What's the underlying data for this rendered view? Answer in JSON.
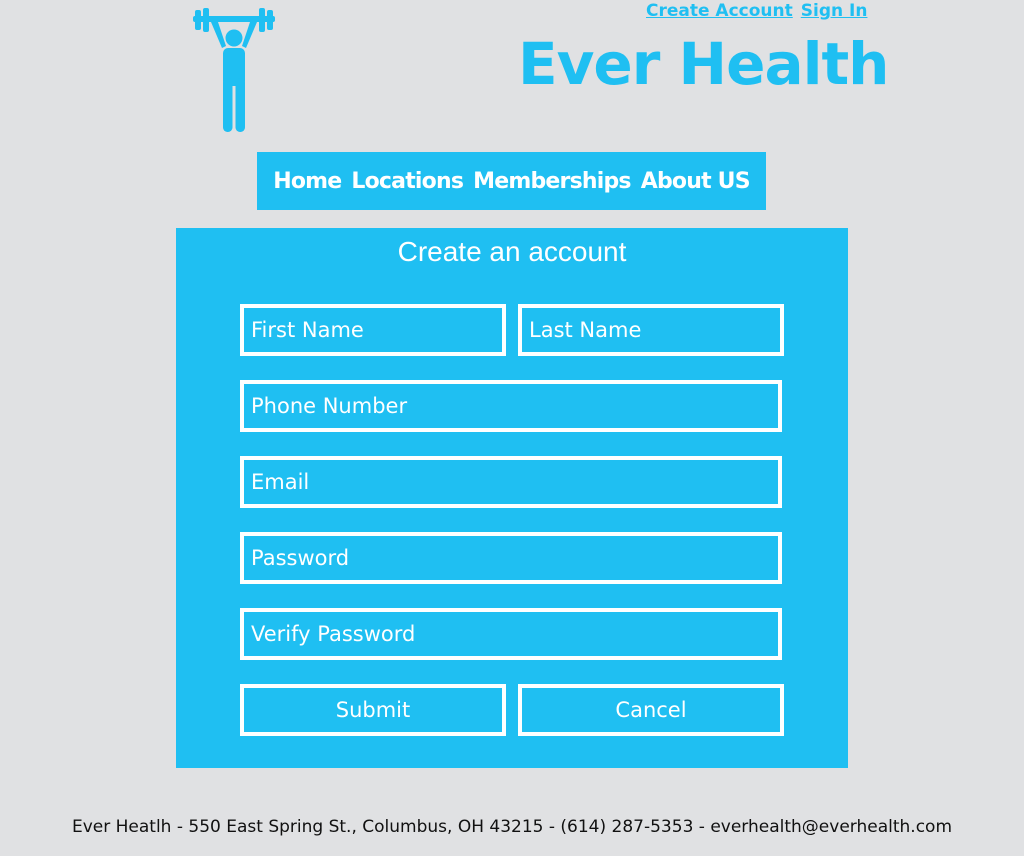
{
  "header": {
    "logo_icon": "weightlifter-icon",
    "create_account_link": "Create Account",
    "sign_in_link": "Sign In",
    "brand_title": "Ever Health",
    "accent_color": "#1fbff2"
  },
  "nav": {
    "items": [
      {
        "label": "Home"
      },
      {
        "label": "Locations"
      },
      {
        "label": "Memberships"
      },
      {
        "label": "About US"
      }
    ]
  },
  "form": {
    "title": "Create an account",
    "first_name_placeholder": "First Name",
    "last_name_placeholder": "Last Name",
    "phone_placeholder": "Phone Number",
    "email_placeholder": "Email",
    "password_placeholder": "Password",
    "verify_password_placeholder": "Verify Password",
    "submit_label": "Submit",
    "cancel_label": "Cancel"
  },
  "footer": {
    "text": "Ever Heatlh - 550 East Spring St., Columbus, OH 43215 - (614) 287-5353 - everhealth@everhealth.com"
  }
}
